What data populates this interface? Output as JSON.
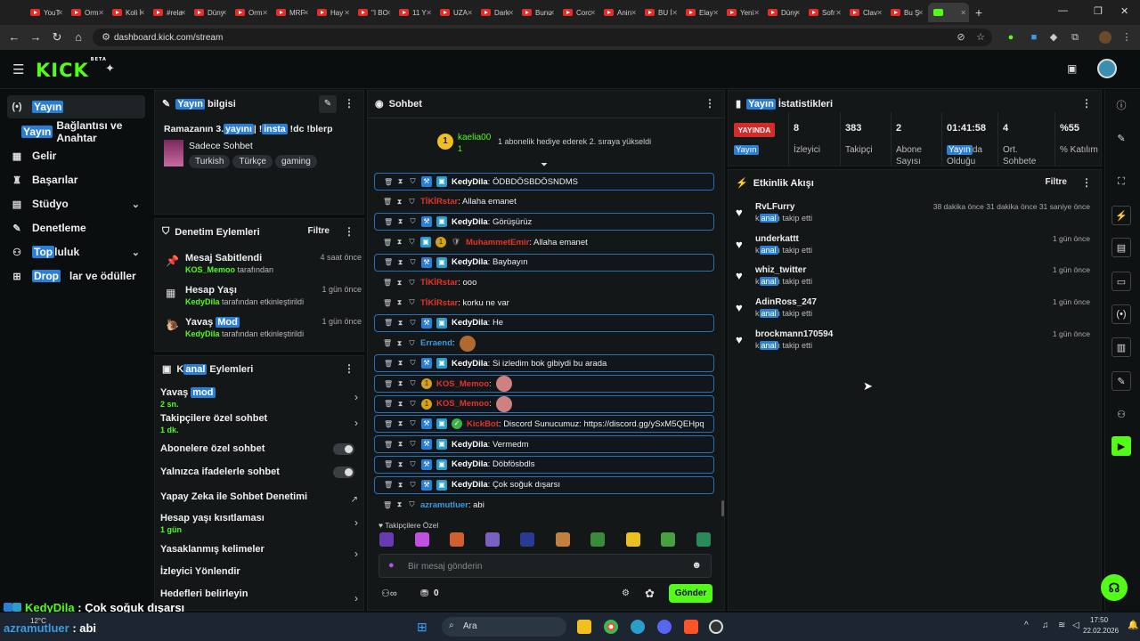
{
  "browser": {
    "tabs": [
      "YouT",
      "Orm",
      "Koli İ",
      "#rela",
      "Düny",
      "Orm",
      "MRF",
      "Hay",
      "\"I BC",
      "11 Y",
      "UZA",
      "Dark",
      "Bunu",
      "Corc",
      "Anin",
      "BU İ",
      "Elay",
      "Yeni",
      "Düny",
      "Sofr",
      "Clav",
      "Bu Ş"
    ],
    "url": "dashboard.kick.com/stream"
  },
  "left_nav": {
    "items": [
      {
        "label": "Yayın",
        "icon": "(•)"
      },
      {
        "label": "Bağlantısı ve Anahtar",
        "prefix": "Yayın"
      },
      {
        "label": "Gelir",
        "icon": "▦"
      },
      {
        "label": "Başarılar",
        "icon": "🏆"
      },
      {
        "label": "Stüdyo",
        "icon": "▦"
      },
      {
        "label": "Denetleme",
        "icon": "🔧"
      },
      {
        "label": "luluk",
        "prefix": "Top",
        "icon": "👥"
      },
      {
        "label": "lar ve ödüller",
        "prefix": "Drop",
        "icon": "⊞"
      }
    ]
  },
  "stream_info": {
    "title_hl": "Yayın",
    "title_rest": " bilgisi",
    "stream_title_a": "Ramazanın 3.",
    "stream_title_hl1": "yayını",
    "stream_title_b": "| !",
    "stream_title_hl2": "insta",
    "stream_title_c": " !dc !blerp",
    "category": "Sadece Sohbet",
    "tags": [
      "Turkish",
      "Türkçe",
      "gaming"
    ]
  },
  "mod_actions": {
    "title": "Denetim Eylemleri",
    "filter": "Filtre",
    "rows": [
      {
        "title": "Mesaj Sabitlendi",
        "user": "KOS_Memoo",
        "suffix": " tarafından",
        "time": "4 saat önce"
      },
      {
        "title": "Hesap Yaşı",
        "user": "KedyDila",
        "suffix": " tarafından etkinleştirildi",
        "time": "1 gün önce"
      },
      {
        "title_a": "Yavaş ",
        "title_hl": "Mod",
        "user": "KedyDila",
        "suffix": " tarafından etkinleştirildi",
        "time": "1 gün önce"
      }
    ]
  },
  "channel_actions": {
    "title_a": "K",
    "title_hl": "anal",
    "title_b": " Eylemleri",
    "rows": [
      {
        "a": "Yavaş ",
        "hl": "mod",
        "sub": "2 sn."
      },
      {
        "a": "Takipçilere özel sohbet",
        "sub": "1 dk."
      },
      {
        "a": "Abonelere özel sohbet"
      },
      {
        "a": "Yalnızca ifadelerle sohbet"
      },
      {
        "a": "Yapay Zeka ile Sohbet Denetimi"
      },
      {
        "a": "Hesap yaşı kısıtlaması",
        "sub": "1 gün"
      },
      {
        "a": "Yasaklanmış kelimeler"
      },
      {
        "a": "İzleyici Yönlendir"
      },
      {
        "a": "Hedefleri belirleyin"
      }
    ]
  },
  "chat": {
    "title": "Sohbet",
    "gift_user": "kaelia00",
    "gift_count": "1",
    "gift_text": "1 abonelik hediye ederek 2. sıraya yükseldi",
    "messages": [
      {
        "user": "KedyDila",
        "text": "ÖDBDÖSBDÖSNDMS",
        "color": "#ffffff"
      },
      {
        "user": "TİKİRstar",
        "text": "Allaha emanet",
        "color": "#e5322d"
      },
      {
        "user": "KedyDila",
        "text": "Görüşürüz",
        "color": "#ffffff"
      },
      {
        "user": "MuhammetEmir",
        "text": "Allaha emanet",
        "color": "#e5322d"
      },
      {
        "user": "KedyDila",
        "text": "Baybayın",
        "color": "#ffffff"
      },
      {
        "user": "TİKİRstar",
        "text": "ooo",
        "color": "#e5322d"
      },
      {
        "user": "TİKİRstar",
        "text": "korku ne var",
        "color": "#e5322d"
      },
      {
        "user": "KedyDila",
        "text": "He",
        "color": "#ffffff"
      },
      {
        "user": "Erraend",
        "text": "",
        "color": "#3a9be0"
      },
      {
        "user": "KedyDila",
        "text": "Si izledim bok gibiydi bu arada",
        "color": "#ffffff"
      },
      {
        "user": "KOS_Memoo",
        "text": "",
        "color": "#e5322d"
      },
      {
        "user": "KOS_Memoo",
        "text": "",
        "color": "#e5322d"
      },
      {
        "user": "KickBot",
        "text": "Discord Sunucumuz: https://discord.gg/ySxM5QEHpq",
        "color": "#e5322d"
      },
      {
        "user": "KedyDila",
        "text": "Vermedm",
        "color": "#ffffff"
      },
      {
        "user": "KedyDila",
        "text": "Döbfösbdls",
        "color": "#ffffff"
      },
      {
        "user": "KedyDila",
        "text": "Çok soğuk dışarsı",
        "color": "#ffffff"
      },
      {
        "user": "azramutluer",
        "text": "abi",
        "color": "#3a9be0"
      }
    ],
    "followers_only_label": "Takipçilere Özel",
    "input_placeholder": "Bir mesaj gönderin",
    "bottom_count": "0",
    "send_label": "Gönder"
  },
  "stats": {
    "title_hl": "Yayın",
    "title_rest": " İstatistikleri",
    "live_badge": "YAYINDA",
    "live_sub": "Yayın",
    "items": [
      {
        "value": "8",
        "label": "İzleyici"
      },
      {
        "value": "383",
        "label": "Takipçi"
      },
      {
        "value": "2",
        "label": "Abone Sayısı"
      },
      {
        "value": "01:41:58",
        "label_hl": "Yayın",
        "label": "da Olduğu"
      },
      {
        "value": "4",
        "label": "Ort. Sohbete"
      },
      {
        "value": "%55",
        "label": "% Katılım"
      }
    ]
  },
  "activity": {
    "title": "Etkinlik Akışı",
    "filter": "Filtre",
    "items": [
      {
        "name": "RvLFurry",
        "desc_a": "k",
        "desc_hl": "anal",
        "desc_b": "ı takip etti",
        "time": "38 dakika önce 31 dakika önce 31 saniye önce"
      },
      {
        "name": "underkattt",
        "desc_a": "k",
        "desc_hl": "anal",
        "desc_b": "ı takip etti",
        "time": "1 gün önce"
      },
      {
        "name": "whiz_twitter",
        "desc_a": "k",
        "desc_hl": "anal",
        "desc_b": "ı takip etti",
        "time": "1 gün önce"
      },
      {
        "name": "AdinRoss_247",
        "desc_a": "k",
        "desc_hl": "anal",
        "desc_b": "ı takip etti",
        "time": "1 gün önce"
      },
      {
        "name": "brockmann170594",
        "desc_a": "k",
        "desc_hl": "anal",
        "desc_b": "ı takip etti",
        "time": "1 gün önce"
      }
    ]
  },
  "overlay": {
    "line1_user": "KedyDila",
    "line1_text": " : Çok soğuk dışarsı",
    "line2_user": "azramutluer",
    "line2_text": " : abi"
  },
  "taskbar": {
    "weather_temp": "12°C",
    "search": "Ara",
    "time": "17:50",
    "date": "22.02.2026"
  },
  "colors": {
    "accent": "#53fc18",
    "highlight": "#2a7fd4",
    "live": "#e5322d"
  }
}
